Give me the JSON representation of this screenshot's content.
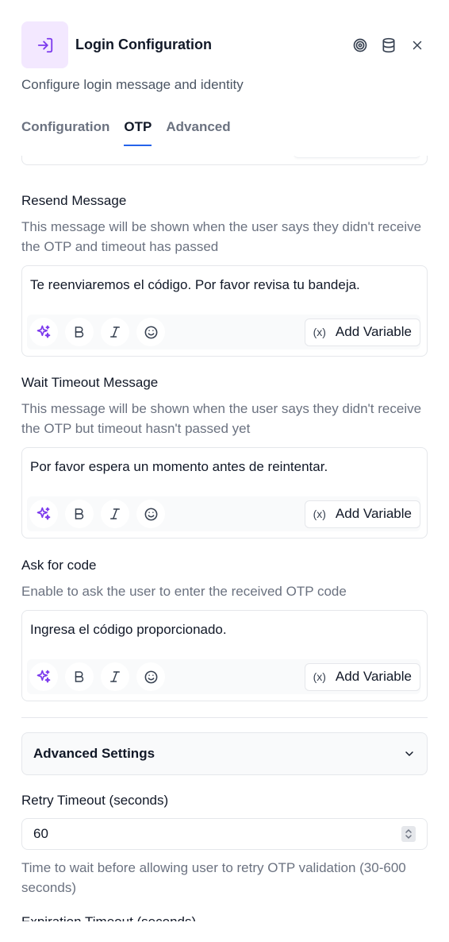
{
  "header": {
    "title": "Login Configuration",
    "subtitle": "Configure login message and identity"
  },
  "tabs": [
    {
      "label": "Configuration",
      "active": false
    },
    {
      "label": "OTP",
      "active": true
    },
    {
      "label": "Advanced",
      "active": false
    }
  ],
  "resend": {
    "label": "Resend Message",
    "help": "This message will be shown when the user says they didn't receive the OTP and timeout has passed",
    "value": "Te reenviaremos el código. Por favor revisa tu bandeja."
  },
  "wait": {
    "label": "Wait Timeout Message",
    "help": "This message will be shown when the user says they didn't receive the OTP but timeout hasn't passed yet",
    "value": "Por favor espera un momento antes de reintentar."
  },
  "ask": {
    "label": "Ask for code",
    "help": "Enable to ask the user to enter the received OTP code",
    "value": "Ingresa el código proporcionado."
  },
  "toolbar": {
    "add_variable": "Add Variable"
  },
  "advanced": {
    "title": "Advanced Settings"
  },
  "retry": {
    "label": "Retry Timeout (seconds)",
    "value": "60",
    "help": "Time to wait before allowing user to retry OTP validation (30-600 seconds)"
  },
  "expiration": {
    "label": "Expiration Timeout (seconds)"
  },
  "colors": {
    "accent": "#2563eb",
    "icon_bg": "#f3e8ff",
    "icon_purple": "#7c3aed"
  }
}
